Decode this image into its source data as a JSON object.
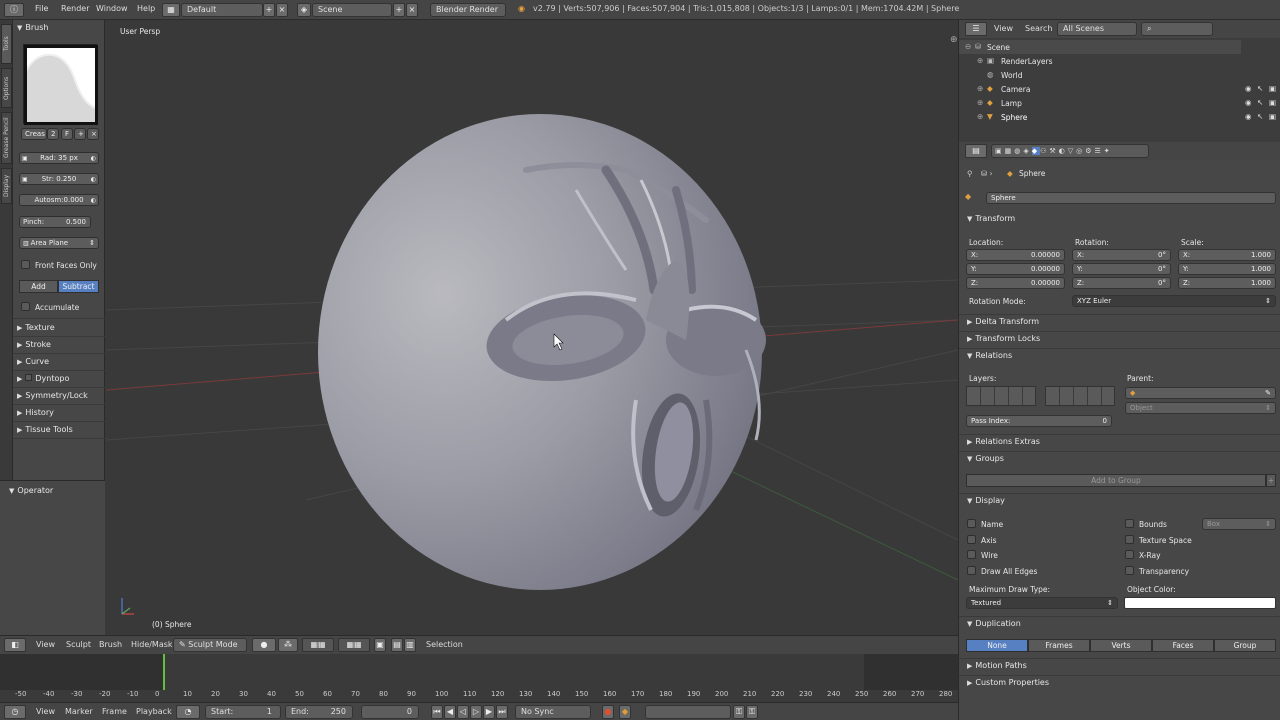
{
  "topbar": {
    "menus": [
      "File",
      "Render",
      "Window",
      "Help"
    ],
    "layout": "Default",
    "scene": "Scene",
    "engine": "Blender Render",
    "info": "v2.79 | Verts:507,906 | Faces:507,904 | Tris:1,015,808 | Objects:1/3 | Lamps:0/1 | Mem:1704.42M | Sphere"
  },
  "shelf_tabs": [
    "Tools",
    "Options",
    "Grease Pencil",
    "Display"
  ],
  "shelf": {
    "brush_header": "Brush",
    "brush_name": "Creas",
    "brush_users": "2",
    "brush_fake": "F",
    "radius": "Rad: 35 px",
    "strength_label": "Str:",
    "strength": "0.250",
    "autosmooth": "Autosm:0.000",
    "pinch_label": "Pinch:",
    "pinch": "0.500",
    "area": "Area Plane",
    "front_faces": "Front Faces Only",
    "add": "Add",
    "subtract": "Subtract",
    "accumulate": "Accumulate",
    "sections": [
      "Texture",
      "Stroke",
      "Curve",
      "Dyntopo",
      "Symmetry/Lock",
      "History",
      "Tissue Tools"
    ],
    "operator": "Operator"
  },
  "viewport": {
    "view_name": "User Persp",
    "object_name": "(0) Sphere"
  },
  "view3d_header": {
    "menus": [
      "View",
      "Sculpt",
      "Brush",
      "Hide/Mask"
    ],
    "mode": "Sculpt Mode",
    "selection": "Selection"
  },
  "timeline": {
    "ticks": [
      "-50",
      "-40",
      "-30",
      "-20",
      "-10",
      "0",
      "10",
      "20",
      "30",
      "40",
      "50",
      "60",
      "70",
      "80",
      "90",
      "100",
      "110",
      "120",
      "130",
      "140",
      "150",
      "160",
      "170",
      "180",
      "190",
      "200",
      "210",
      "220",
      "230",
      "240",
      "250",
      "260",
      "270",
      "280"
    ],
    "menus": [
      "View",
      "Marker",
      "Frame",
      "Playback"
    ],
    "start_label": "Start:",
    "start": "1",
    "end_label": "End:",
    "end": "250",
    "current": "0",
    "sync": "No Sync"
  },
  "outliner": {
    "menus": [
      "View",
      "Search"
    ],
    "scenes": "All Scenes",
    "items": [
      "Scene",
      "RenderLayers",
      "World",
      "Camera",
      "Lamp",
      "Sphere"
    ]
  },
  "props": {
    "object": "Sphere",
    "object_field": "Sphere",
    "transform": "Transform",
    "location": "Location:",
    "rotation": "Rotation:",
    "scale": "Scale:",
    "loc": [
      "X:",
      "0.00000",
      "Y:",
      "0.00000",
      "Z:",
      "0.00000"
    ],
    "rot": [
      "X:",
      "0°",
      "Y:",
      "0°",
      "Z:",
      "0°"
    ],
    "scl": [
      "X:",
      "1.000",
      "Y:",
      "1.000",
      "Z:",
      "1.000"
    ],
    "rotation_mode_label": "Rotation Mode:",
    "rotation_mode": "XYZ Euler",
    "delta": "Delta Transform",
    "locks": "Transform Locks",
    "relations": "Relations",
    "layers": "Layers:",
    "parent": "Parent:",
    "parent_type": "Object",
    "pass_index_label": "Pass Index:",
    "pass_index": "0",
    "relations_extras": "Relations Extras",
    "groups": "Groups",
    "add_to_group": "Add to Group",
    "display": "Display",
    "disp_left": [
      "Name",
      "Axis",
      "Wire",
      "Draw All Edges"
    ],
    "disp_right": [
      "Bounds",
      "Texture Space",
      "X-Ray",
      "Transparency"
    ],
    "bounds_type": "Box",
    "max_draw_label": "Maximum Draw Type:",
    "max_draw": "Textured",
    "obj_color_label": "Object Color:",
    "duplication": "Duplication",
    "dup": [
      "None",
      "Frames",
      "Verts",
      "Faces",
      "Group"
    ],
    "motion": "Motion Paths",
    "custom": "Custom Properties"
  },
  "colors": {
    "accent": "#5680c2",
    "timeline_cursor": "#60c040"
  }
}
